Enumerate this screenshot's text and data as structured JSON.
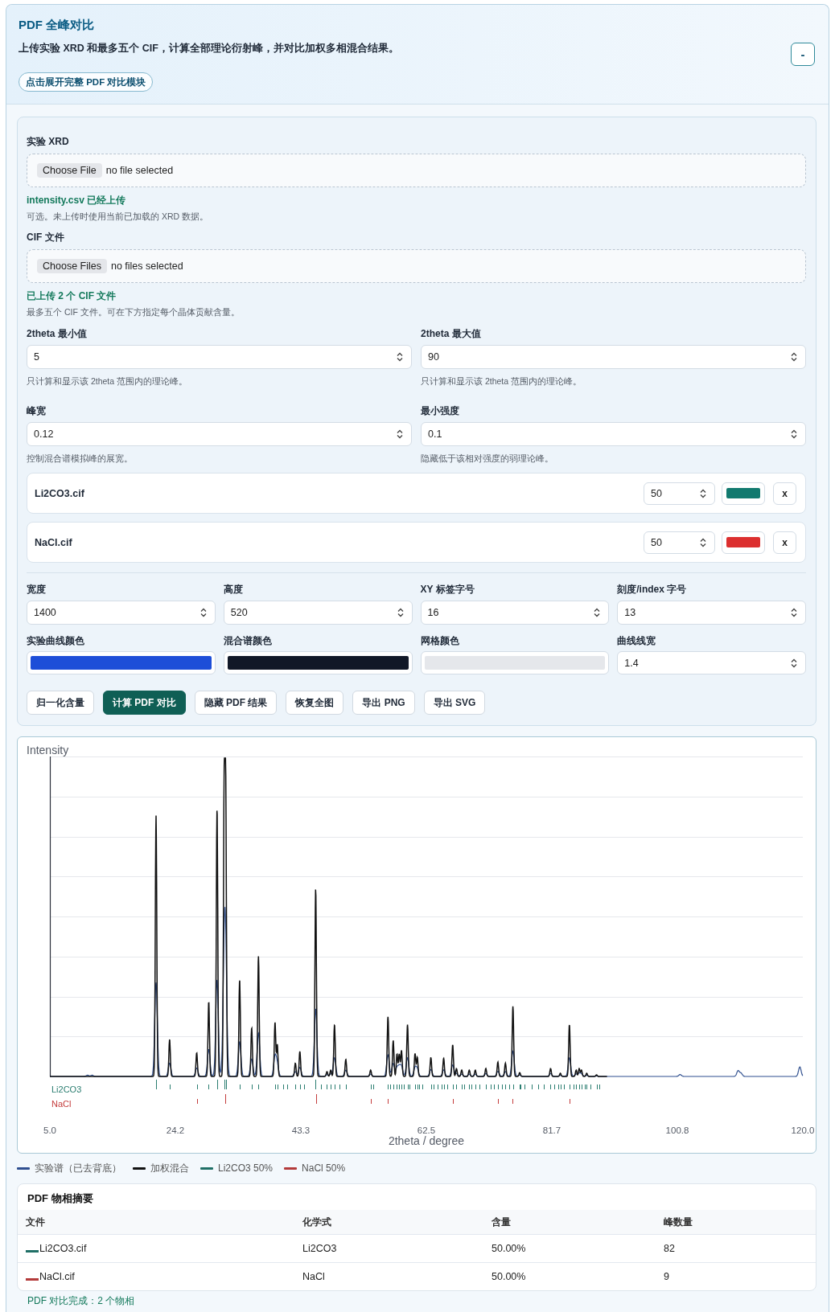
{
  "header": {
    "title": "PDF 全峰对比",
    "description": "上传实验 XRD 和最多五个 CIF，计算全部理论衍射峰，并对比加权多相混合结果。",
    "expand_button": "点击展开完整 PDF 对比模块",
    "collapse_button": "-"
  },
  "uploads": [
    {
      "label": "实验 XRD",
      "button": "Choose File",
      "file_status": "no file selected",
      "upload_status": "intensity.csv 已经上传",
      "hint": "可选。未上传时使用当前已加载的 XRD 数据。"
    },
    {
      "label": "CIF 文件",
      "button": "Choose Files",
      "file_status": "no files selected",
      "upload_status": "已上传 2 个 CIF 文件",
      "hint": "最多五个 CIF 文件。可在下方指定每个晶体贡献含量。"
    }
  ],
  "range_fields": [
    {
      "label": "2theta 最小值",
      "value": "5",
      "hint": "只计算和显示该 2theta 范围内的理论峰。"
    },
    {
      "label": "2theta 最大值",
      "value": "90",
      "hint": "只计算和显示该 2theta 范围内的理论峰。"
    },
    {
      "label": "峰宽",
      "value": "0.12",
      "hint": "控制混合谱模拟峰的展宽。"
    },
    {
      "label": "最小强度",
      "value": "0.1",
      "hint": "隐藏低于该相对强度的弱理论峰。"
    }
  ],
  "cif_files": [
    {
      "name": "Li2CO3.cif",
      "weight": "50",
      "color": "#127a6f",
      "remove_button": "x"
    },
    {
      "name": "NaCl.cif",
      "weight": "50",
      "color": "#dc2f2f",
      "remove_button": "x"
    }
  ],
  "plot_settings": [
    {
      "kind": "number",
      "label": "宽度",
      "value": "1400"
    },
    {
      "kind": "number",
      "label": "高度",
      "value": "520"
    },
    {
      "kind": "number",
      "label": "XY 标签字号",
      "value": "16"
    },
    {
      "kind": "number",
      "label": "刻度/index 字号",
      "value": "13"
    },
    {
      "kind": "color",
      "label": "实验曲线颜色",
      "color": "#1d4ed8"
    },
    {
      "kind": "color",
      "label": "混合谱颜色",
      "color": "#111827"
    },
    {
      "kind": "color",
      "label": "网格颜色",
      "color": "#e5e7eb"
    },
    {
      "kind": "number",
      "label": "曲线线宽",
      "value": "1.4"
    }
  ],
  "actions": [
    {
      "label": "归一化含量",
      "primary": false
    },
    {
      "label": "计算 PDF 对比",
      "primary": true
    },
    {
      "label": "隐藏 PDF 结果",
      "primary": false
    },
    {
      "label": "恢复全图",
      "primary": false
    },
    {
      "label": "导出 PNG",
      "primary": false
    },
    {
      "label": "导出 SVG",
      "primary": false
    }
  ],
  "chart": {
    "y_label": "Intensity",
    "x_label": "2theta / degree",
    "x_tick_labels": [
      "5.0",
      "24.2",
      "43.3",
      "62.5",
      "81.7",
      "100.8",
      "120.0"
    ],
    "phase_rows": [
      {
        "label": "Li2CO3",
        "color": "#2a7d70"
      },
      {
        "label": "NaCl",
        "color": "#c43c3c"
      }
    ]
  },
  "legend": [
    {
      "label": "实验谱（已去背底）",
      "color": "#2f4f8f"
    },
    {
      "label": "加权混合",
      "color": "#111111"
    },
    {
      "label": "Li2CO3 50%",
      "color": "#1f6f66"
    },
    {
      "label": "NaCl 50%",
      "color": "#b33a3a"
    }
  ],
  "summary": {
    "title": "PDF 物相摘要",
    "columns": [
      "文件",
      "化学式",
      "含量",
      "峰数量"
    ],
    "rows": [
      {
        "file": "Li2CO3.cif",
        "color": "#1f6f66",
        "formula": "Li2CO3",
        "content": "50.00%",
        "peaks": "82"
      },
      {
        "file": "NaCl.cif",
        "color": "#b33a3a",
        "formula": "NaCl",
        "content": "50.00%",
        "peaks": "9"
      }
    ]
  },
  "status": "PDF 对比完成：2 个物相"
}
